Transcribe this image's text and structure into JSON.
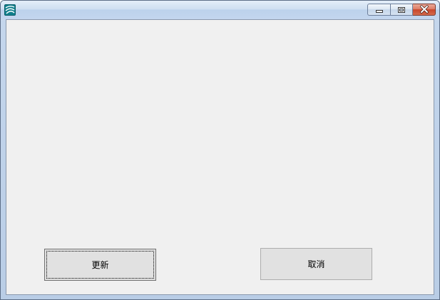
{
  "window": {
    "icon": "app-icon",
    "controls": {
      "minimize_icon": "minimize-icon",
      "maximize_icon": "restore-icon",
      "close_icon": "close-icon"
    }
  },
  "buttons": {
    "update_label": "更新",
    "cancel_label": "取消"
  },
  "colors": {
    "client_background": "#f0f0f0",
    "button_face": "#e1e1e1",
    "close_button": "#c8452a"
  }
}
